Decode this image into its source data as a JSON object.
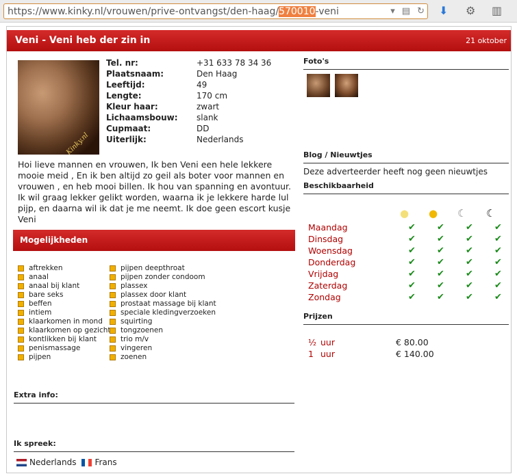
{
  "browser": {
    "url_prefix": "https://www.kinky.nl/vrouwen/prive-ontvangst/den-haag/",
    "url_highlight": "570010",
    "url_suffix": "-veni"
  },
  "header": {
    "title": "Veni - Veni heb der zin in",
    "date": "21 oktober"
  },
  "photo": {
    "watermark": "Kinky.nl"
  },
  "profile": [
    {
      "label": "Tel. nr:",
      "value": "+31 633 78 34 36"
    },
    {
      "label": "Plaatsnaam:",
      "value": "Den Haag"
    },
    {
      "label": "Leeftijd:",
      "value": "49"
    },
    {
      "label": "Lengte:",
      "value": "170 cm"
    },
    {
      "label": "Kleur haar:",
      "value": "zwart"
    },
    {
      "label": "Lichaamsbouw:",
      "value": "slank"
    },
    {
      "label": "Cupmaat:",
      "value": "DD"
    },
    {
      "label": "Uiterlijk:",
      "value": "Nederlands"
    }
  ],
  "bio": "Hoi lieve mannen en vrouwen, Ik ben Veni een hele lekkere mooie meid , En ik ben altijd zo geil als boter voor mannen en vrouwen , en heb mooi billen. Ik hou van spanning en avontuur. Ik wil graag lekker gelikt worden, waarna ik je lekkere harde lul pijp, en daarna wil ik dat je me neemt. Ik doe geen escort kusje Veni",
  "options": {
    "heading": "Mogelijkheden",
    "col1": [
      "aftrekken",
      "anaal",
      "anaal bij klant",
      "bare seks",
      "beffen",
      "intiem",
      "klaarkomen in mond",
      "klaarkomen op gezicht",
      "kontlikken bij klant",
      "penismassage",
      "pijpen"
    ],
    "col2": [
      "pijpen deepthroat",
      "pijpen zonder condoom",
      "plassex",
      "plassex door klant",
      "prostaat massage bij klant",
      "speciale kledingverzoeken",
      "squirting",
      "tongzoenen",
      "trio m/v",
      "vingeren",
      "zoenen"
    ]
  },
  "extra": {
    "heading": "Extra info:"
  },
  "languages": {
    "heading": "Ik spreek:",
    "items": [
      "Nederlands",
      "Frans"
    ]
  },
  "photos": {
    "heading": "Foto's"
  },
  "blog": {
    "heading": "Blog / Nieuwtjes",
    "text": "Deze adverteerder heeft nog geen nieuwtjes"
  },
  "availability": {
    "heading": "Beschikbaarheid",
    "days": [
      "Maandag",
      "Dinsdag",
      "Woensdag",
      "Donderdag",
      "Vrijdag",
      "Zaterdag",
      "Zondag"
    ],
    "check": "✔"
  },
  "prices": {
    "heading": "Prijzen",
    "rows": [
      {
        "qty": "½",
        "unit": "uur",
        "price": "€ 80.00"
      },
      {
        "qty": "1",
        "unit": "uur",
        "price": "€ 140.00"
      }
    ]
  },
  "colors": {
    "accent": "#c41a1a",
    "check": "#1a8a1a",
    "option_square": "#f0b000"
  }
}
